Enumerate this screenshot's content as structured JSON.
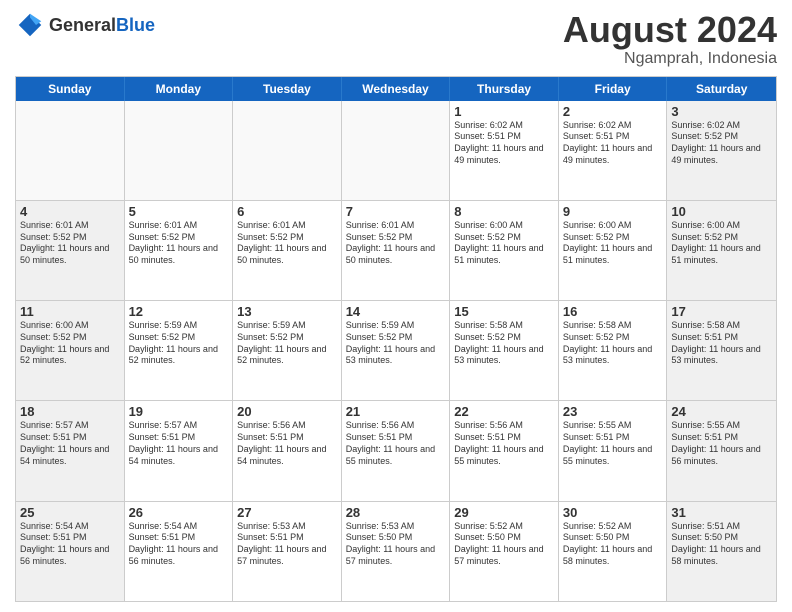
{
  "logo": {
    "general": "General",
    "blue": "Blue"
  },
  "header": {
    "title": "August 2024",
    "subtitle": "Ngamprah, Indonesia"
  },
  "days": [
    "Sunday",
    "Monday",
    "Tuesday",
    "Wednesday",
    "Thursday",
    "Friday",
    "Saturday"
  ],
  "rows": [
    [
      {
        "day": "",
        "info": ""
      },
      {
        "day": "",
        "info": ""
      },
      {
        "day": "",
        "info": ""
      },
      {
        "day": "",
        "info": ""
      },
      {
        "day": "1",
        "info": "Sunrise: 6:02 AM\nSunset: 5:51 PM\nDaylight: 11 hours\nand 49 minutes."
      },
      {
        "day": "2",
        "info": "Sunrise: 6:02 AM\nSunset: 5:51 PM\nDaylight: 11 hours\nand 49 minutes."
      },
      {
        "day": "3",
        "info": "Sunrise: 6:02 AM\nSunset: 5:52 PM\nDaylight: 11 hours\nand 49 minutes."
      }
    ],
    [
      {
        "day": "4",
        "info": "Sunrise: 6:01 AM\nSunset: 5:52 PM\nDaylight: 11 hours\nand 50 minutes."
      },
      {
        "day": "5",
        "info": "Sunrise: 6:01 AM\nSunset: 5:52 PM\nDaylight: 11 hours\nand 50 minutes."
      },
      {
        "day": "6",
        "info": "Sunrise: 6:01 AM\nSunset: 5:52 PM\nDaylight: 11 hours\nand 50 minutes."
      },
      {
        "day": "7",
        "info": "Sunrise: 6:01 AM\nSunset: 5:52 PM\nDaylight: 11 hours\nand 50 minutes."
      },
      {
        "day": "8",
        "info": "Sunrise: 6:00 AM\nSunset: 5:52 PM\nDaylight: 11 hours\nand 51 minutes."
      },
      {
        "day": "9",
        "info": "Sunrise: 6:00 AM\nSunset: 5:52 PM\nDaylight: 11 hours\nand 51 minutes."
      },
      {
        "day": "10",
        "info": "Sunrise: 6:00 AM\nSunset: 5:52 PM\nDaylight: 11 hours\nand 51 minutes."
      }
    ],
    [
      {
        "day": "11",
        "info": "Sunrise: 6:00 AM\nSunset: 5:52 PM\nDaylight: 11 hours\nand 52 minutes."
      },
      {
        "day": "12",
        "info": "Sunrise: 5:59 AM\nSunset: 5:52 PM\nDaylight: 11 hours\nand 52 minutes."
      },
      {
        "day": "13",
        "info": "Sunrise: 5:59 AM\nSunset: 5:52 PM\nDaylight: 11 hours\nand 52 minutes."
      },
      {
        "day": "14",
        "info": "Sunrise: 5:59 AM\nSunset: 5:52 PM\nDaylight: 11 hours\nand 53 minutes."
      },
      {
        "day": "15",
        "info": "Sunrise: 5:58 AM\nSunset: 5:52 PM\nDaylight: 11 hours\nand 53 minutes."
      },
      {
        "day": "16",
        "info": "Sunrise: 5:58 AM\nSunset: 5:52 PM\nDaylight: 11 hours\nand 53 minutes."
      },
      {
        "day": "17",
        "info": "Sunrise: 5:58 AM\nSunset: 5:51 PM\nDaylight: 11 hours\nand 53 minutes."
      }
    ],
    [
      {
        "day": "18",
        "info": "Sunrise: 5:57 AM\nSunset: 5:51 PM\nDaylight: 11 hours\nand 54 minutes."
      },
      {
        "day": "19",
        "info": "Sunrise: 5:57 AM\nSunset: 5:51 PM\nDaylight: 11 hours\nand 54 minutes."
      },
      {
        "day": "20",
        "info": "Sunrise: 5:56 AM\nSunset: 5:51 PM\nDaylight: 11 hours\nand 54 minutes."
      },
      {
        "day": "21",
        "info": "Sunrise: 5:56 AM\nSunset: 5:51 PM\nDaylight: 11 hours\nand 55 minutes."
      },
      {
        "day": "22",
        "info": "Sunrise: 5:56 AM\nSunset: 5:51 PM\nDaylight: 11 hours\nand 55 minutes."
      },
      {
        "day": "23",
        "info": "Sunrise: 5:55 AM\nSunset: 5:51 PM\nDaylight: 11 hours\nand 55 minutes."
      },
      {
        "day": "24",
        "info": "Sunrise: 5:55 AM\nSunset: 5:51 PM\nDaylight: 11 hours\nand 56 minutes."
      }
    ],
    [
      {
        "day": "25",
        "info": "Sunrise: 5:54 AM\nSunset: 5:51 PM\nDaylight: 11 hours\nand 56 minutes."
      },
      {
        "day": "26",
        "info": "Sunrise: 5:54 AM\nSunset: 5:51 PM\nDaylight: 11 hours\nand 56 minutes."
      },
      {
        "day": "27",
        "info": "Sunrise: 5:53 AM\nSunset: 5:51 PM\nDaylight: 11 hours\nand 57 minutes."
      },
      {
        "day": "28",
        "info": "Sunrise: 5:53 AM\nSunset: 5:50 PM\nDaylight: 11 hours\nand 57 minutes."
      },
      {
        "day": "29",
        "info": "Sunrise: 5:52 AM\nSunset: 5:50 PM\nDaylight: 11 hours\nand 57 minutes."
      },
      {
        "day": "30",
        "info": "Sunrise: 5:52 AM\nSunset: 5:50 PM\nDaylight: 11 hours\nand 58 minutes."
      },
      {
        "day": "31",
        "info": "Sunrise: 5:51 AM\nSunset: 5:50 PM\nDaylight: 11 hours\nand 58 minutes."
      }
    ]
  ]
}
